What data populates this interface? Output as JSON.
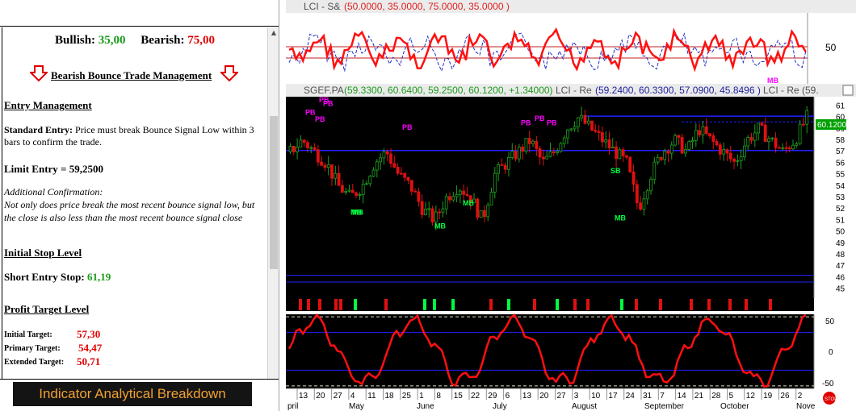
{
  "left_panel": {
    "bullish_label": "Bullish:",
    "bullish_value": "35,00",
    "bearish_label": "Bearish:",
    "bearish_value": "75,00",
    "management_title": "Bearish Bounce Trade Management",
    "entry_management_heading": "Entry Management",
    "standard_entry_label": "Standard Entry:",
    "standard_entry_text": "Price must break Bounce Signal Low within 3 bars to confirm the trade.",
    "limit_entry": "Limit Entry = 59,2500",
    "additional_confirmation_label": "Additional Confirmation:",
    "additional_confirmation_text": "Not only does price break the most recent bounce signal low, but the close is also less than the most recent bounce signal close",
    "initial_stop_heading": "Initial Stop Level",
    "short_entry_stop_label": "Short Entry Stop:",
    "short_entry_stop_value": "61,19",
    "profit_target_heading": "Profit Target Level",
    "targets": [
      {
        "label": "Initial Target:",
        "value": "57,30"
      },
      {
        "label": "Primary Target:",
        "value": "54,47"
      },
      {
        "label": "Extended Target:",
        "value": "50,71"
      }
    ],
    "breakdown_button": "Indicator Analytical Breakdown"
  },
  "top_pane": {
    "title": "LCI - S&",
    "params": "(50.0000, 35.0000, 75.0000, 35.0000 )",
    "axis_label": "50"
  },
  "price_pane": {
    "symbol": "SGEF.PA",
    "ohlc": "(59.3300, 60.6400, 59.2500, 60.1200, +1.34000)",
    "lci_re_label": "LCI - Re",
    "lci_re_values": "(59.2400, 60.3300, 57.0900, 45.8496 )",
    "lci_re_label_2": "LCI - Re (59.",
    "last_price": "60.1200",
    "y_ticks": [
      "61",
      "60",
      "59",
      "58",
      "57",
      "56",
      "55",
      "54",
      "53",
      "52",
      "51",
      "50",
      "49",
      "48",
      "47",
      "46",
      "45"
    ],
    "signals": [
      "PB",
      "PB",
      "PB",
      "PB",
      "PB",
      "MB",
      "PB",
      "PB",
      "MB",
      "MB",
      "MB",
      "PB",
      "SB",
      "MB",
      "MB"
    ]
  },
  "osc_pane": {
    "y_ticks": [
      "50",
      "0",
      "-50"
    ]
  },
  "x_axis": {
    "days": [
      "13",
      "20",
      "27",
      "4",
      "11",
      "18",
      "25",
      "1",
      "8",
      "15",
      "22",
      "29",
      "6",
      "13",
      "20",
      "27",
      "3",
      "10",
      "17",
      "24",
      "31",
      "7",
      "14",
      "21",
      "28",
      "5",
      "12",
      "19",
      "26",
      "2"
    ],
    "months": [
      "pril",
      "May",
      "June",
      "July",
      "August",
      "September",
      "October",
      "Nove"
    ]
  },
  "colors": {
    "bullish": "#1a9a1a",
    "bearish": "#e00000",
    "oscillator": "#ff1010",
    "signal_magenta": "#ff00ff",
    "signal_green": "#00ff40",
    "level_blue": "#2020ff"
  }
}
